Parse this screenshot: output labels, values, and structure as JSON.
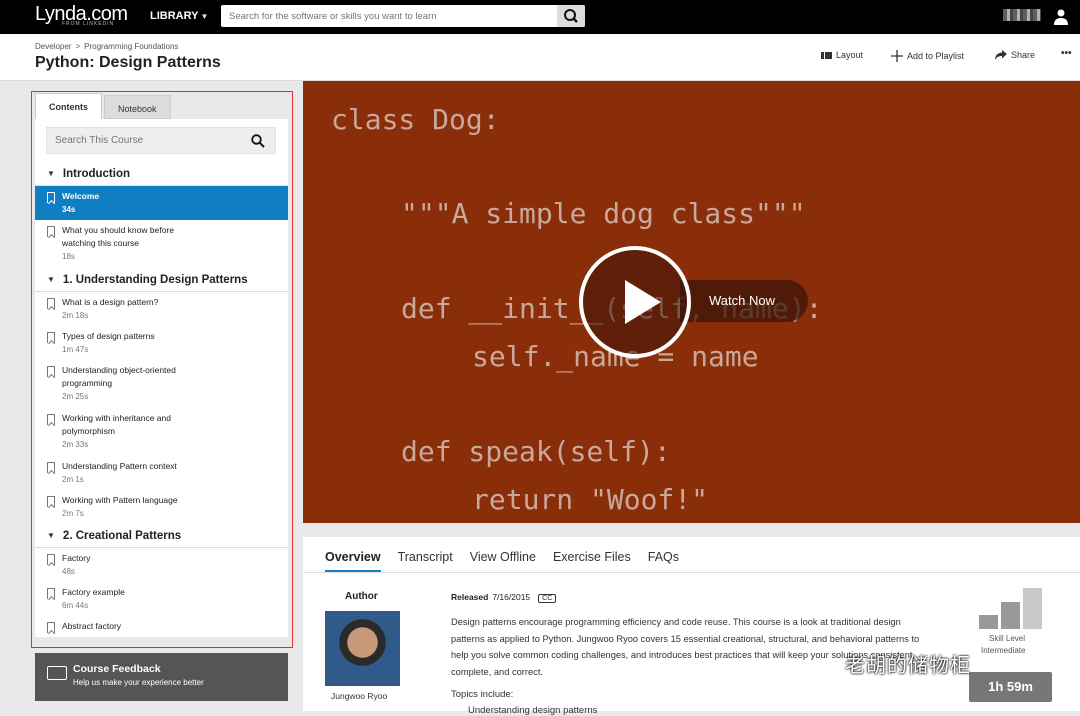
{
  "topbar": {
    "logo": "Lynda.com",
    "logo_sub": "FROM LINKEDIN",
    "library": "LIBRARY",
    "search_placeholder": "Search for the software or skills you want to learn"
  },
  "header": {
    "breadcrumb": [
      "Developer",
      "Programming Foundations"
    ],
    "title": "Python: Design Patterns",
    "actions": {
      "layout": "Layout",
      "playlist": "Add to Playlist",
      "share": "Share",
      "more": "•••"
    }
  },
  "sidebar": {
    "tabs": [
      "Contents",
      "Notebook"
    ],
    "search_placeholder": "Search This Course",
    "sections": [
      {
        "title": "Introduction",
        "items": [
          {
            "title": "Welcome",
            "duration": "34s",
            "selected": true
          },
          {
            "title": "What you should know before watching this course",
            "duration": "18s"
          }
        ]
      },
      {
        "title": "1. Understanding Design Patterns",
        "items": [
          {
            "title": "What is a design pattern?",
            "duration": "2m 18s"
          },
          {
            "title": "Types of design patterns",
            "duration": "1m 47s"
          },
          {
            "title": "Understanding object-oriented programming",
            "duration": "2m 25s"
          },
          {
            "title": "Working with inheritance and polymorphism",
            "duration": "2m 33s"
          },
          {
            "title": "Understanding Pattern context",
            "duration": "2m 1s"
          },
          {
            "title": "Working with Pattern language",
            "duration": "2m 7s"
          }
        ]
      },
      {
        "title": "2. Creational Patterns",
        "items": [
          {
            "title": "Factory",
            "duration": "48s"
          },
          {
            "title": "Factory example",
            "duration": "6m 44s"
          },
          {
            "title": "Abstract factory",
            "duration": ""
          }
        ]
      }
    ],
    "feedback": {
      "title": "Course Feedback",
      "subtitle": "Help us make your experience better"
    }
  },
  "video": {
    "code_lines": [
      "class Dog:",
      "\"\"\"A simple dog class\"\"\"",
      "def __init__(self, name):",
      "self._name = name",
      "def speak(self):",
      "return \"Woof!\""
    ],
    "watch_now": "Watch Now"
  },
  "info": {
    "tabs": [
      "Overview",
      "Transcript",
      "View Offline",
      "Exercise Files",
      "FAQs"
    ],
    "author_label": "Author",
    "author_name": "Jungwoo Ryoo",
    "released_label": "Released",
    "released_date": "7/16/2015",
    "cc": "CC",
    "description": "Design patterns encourage programming efficiency and code reuse. This course is a look at traditional design patterns as applied to Python. Jungwoo Ryoo covers 15 essential creational, structural, and behavioral patterns to help you solve common coding challenges, and introduces best practices that will keep your solutions consistent, complete, and correct.",
    "topics_label": "Topics include:",
    "topic_first": "Understanding design patterns",
    "skill_label": "Skill Level",
    "skill_value": "Intermediate",
    "skill_level": 2,
    "skill_levels_total": 3,
    "duration": "1h 59m"
  },
  "watermark": "老胡的储物柜"
}
